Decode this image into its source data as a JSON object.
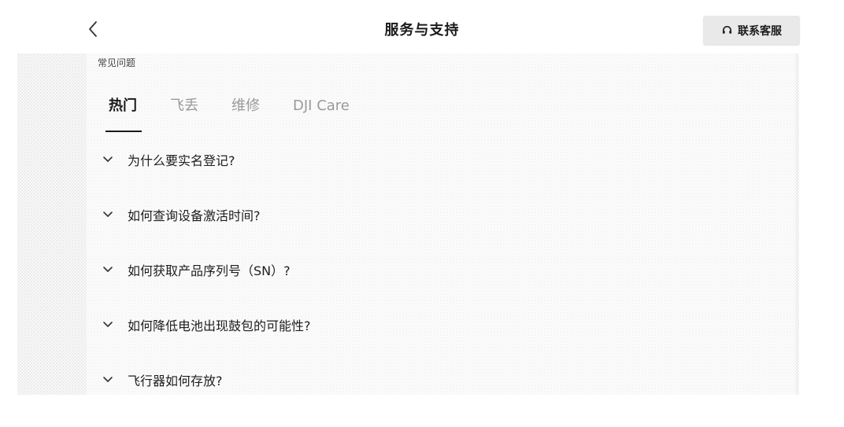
{
  "header": {
    "title": "服务与支持",
    "back_icon": "chevron-left-icon",
    "contact_icon": "headset-icon",
    "contact_label": "联系客服"
  },
  "faq": {
    "section_label": "常见问题",
    "tabs": [
      {
        "label": "热门",
        "active": true
      },
      {
        "label": "飞丢",
        "active": false
      },
      {
        "label": "维修",
        "active": false
      },
      {
        "label": "DJI Care",
        "active": false
      }
    ],
    "items": [
      {
        "question": "为什么要实名登记?"
      },
      {
        "question": "如何查询设备激活时间?"
      },
      {
        "question": "如何获取产品序列号（SN）?"
      },
      {
        "question": "如何降低电池出现鼓包的可能性?"
      },
      {
        "question": "飞行器如何存放?"
      }
    ]
  },
  "colors": {
    "text_primary": "#1a1a1a",
    "text_muted": "#9a9a9a",
    "button_bg": "#e9e9e9"
  }
}
